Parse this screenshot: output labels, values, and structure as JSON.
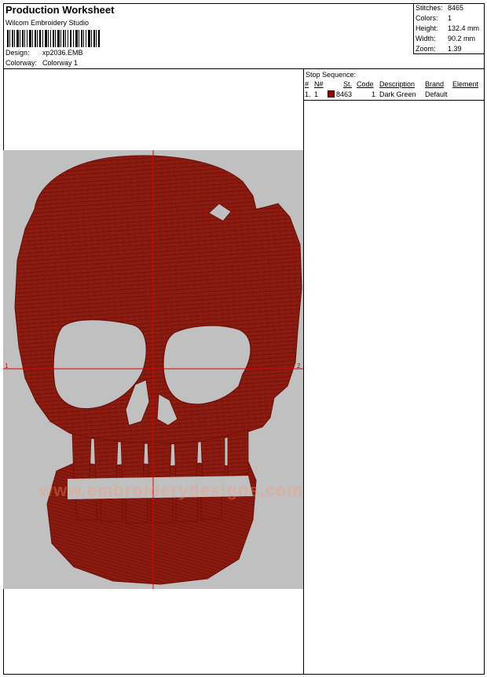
{
  "header": {
    "title": "Production Worksheet",
    "company": "Wilcom Embroidery Studio",
    "design_label": "Design:",
    "design_value": "xp2036.EMB",
    "colorway_label": "Colorway:",
    "colorway_value": "Colorway 1"
  },
  "stats": [
    {
      "label": "Stitches:",
      "value": "8465"
    },
    {
      "label": "Colors:",
      "value": "1"
    },
    {
      "label": "Height:",
      "value": "132.4 mm"
    },
    {
      "label": "Width:",
      "value": "90.2 mm"
    },
    {
      "label": "Zoom:",
      "value": "1.39"
    }
  ],
  "stop_sequence": {
    "title": "Stop Sequence:",
    "columns": [
      "#",
      "N#",
      "St.",
      "Code",
      "Description",
      "Brand",
      "Element"
    ],
    "rows": [
      {
        "num": "1.",
        "n": "1",
        "color": "#8b0000",
        "st": "8463",
        "code": "1",
        "description": "Dark Green",
        "brand": "Default",
        "element": ""
      }
    ]
  },
  "design": {
    "watermark": "www.embroiderydesigns.com",
    "marker_left": "1",
    "marker_right": "2",
    "thread_color": "#8b1a10",
    "background_color": "#c0c0c0",
    "crosshair_color": "#dd0000"
  }
}
